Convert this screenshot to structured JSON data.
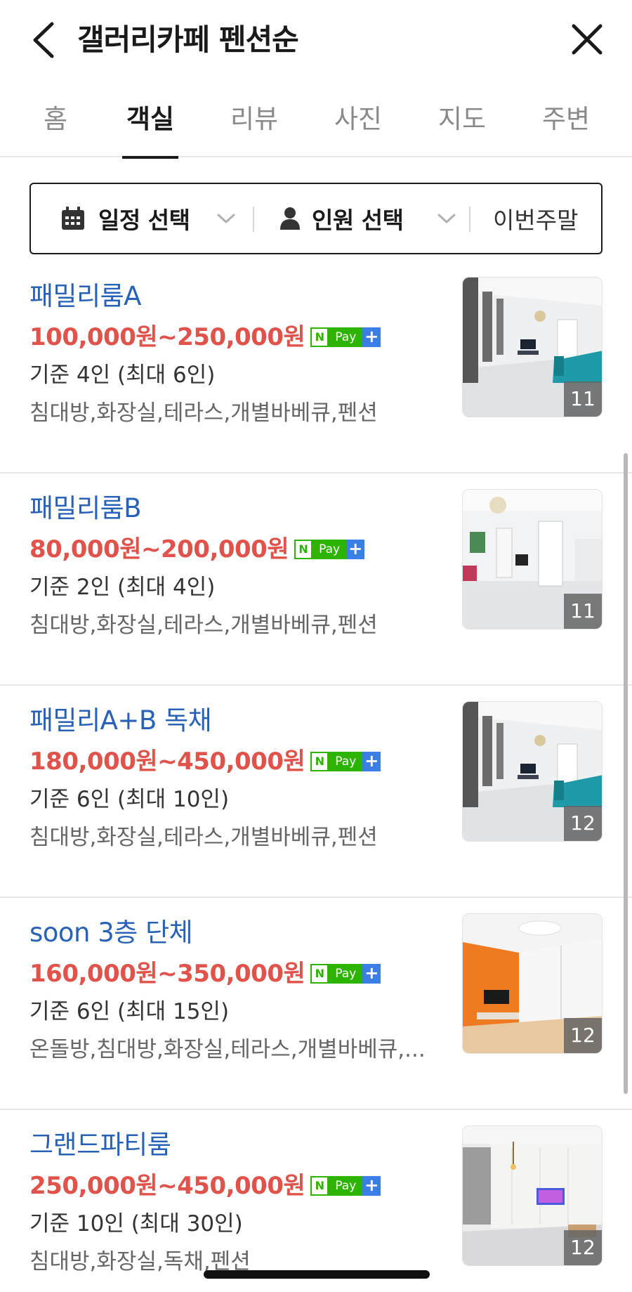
{
  "header": {
    "title": "갤러리카페 펜션순"
  },
  "tabs": [
    {
      "label": "홈"
    },
    {
      "label": "객실"
    },
    {
      "label": "리뷰"
    },
    {
      "label": "사진"
    },
    {
      "label": "지도"
    },
    {
      "label": "주변"
    }
  ],
  "active_tab": "객실",
  "filter": {
    "date_label": "일정 선택",
    "people_label": "인원 선택",
    "weekend_label": "이번주말"
  },
  "npay": {
    "n": "N",
    "pay": "Pay",
    "plus": "+"
  },
  "rooms": [
    {
      "name": "패밀리룸A",
      "price": "100,000원~250,000원",
      "capacity": "기준 4인 (최대 6인)",
      "amenities": "침대방,화장실,테라스,개별바베큐,펜션",
      "photo_count": "11"
    },
    {
      "name": "패밀리룸B",
      "price": "80,000원~200,000원",
      "capacity": "기준 2인 (최대 4인)",
      "amenities": "침대방,화장실,테라스,개별바베큐,펜션",
      "photo_count": "11"
    },
    {
      "name": "패밀리A+B 독채",
      "price": "180,000원~450,000원",
      "capacity": "기준 6인 (최대 10인)",
      "amenities": "침대방,화장실,테라스,개별바베큐,펜션",
      "photo_count": "12"
    },
    {
      "name": "soon 3층 단체",
      "price": "160,000원~350,000원",
      "capacity": "기준 6인 (최대 15인)",
      "amenities": "온돌방,침대방,화장실,테라스,개별바베큐,...",
      "photo_count": "12"
    },
    {
      "name": "그랜드파티룸",
      "price": "250,000원~450,000원",
      "capacity": "기준 10인 (최대 30인)",
      "amenities": "침대방,화장실,독채,펜션",
      "photo_count": "12"
    }
  ],
  "colors": {
    "room_name": "#2862b8",
    "price": "#e0524a",
    "npay_green": "#2db400",
    "npay_blue": "#3c7ee8"
  }
}
